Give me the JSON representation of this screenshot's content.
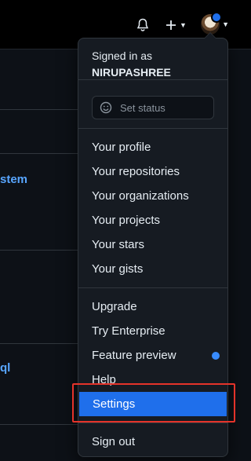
{
  "header": {
    "bell_icon": "bell-icon",
    "plus_icon": "plus-icon",
    "avatar": "avatar-image"
  },
  "background": {
    "link1": "stem",
    "link2": "ql"
  },
  "menu": {
    "signed_in_label": "Signed in as",
    "username": "NIRUPASHREE",
    "status_label": "Set status",
    "items_group1": [
      "Your profile",
      "Your repositories",
      "Your organizations",
      "Your projects",
      "Your stars",
      "Your gists"
    ],
    "items_group2": [
      "Upgrade",
      "Try Enterprise",
      "Feature preview",
      "Help",
      "Settings"
    ],
    "sign_out": "Sign out"
  },
  "colors": {
    "accent": "#1f6feb",
    "highlight_box": "#e5332a"
  }
}
